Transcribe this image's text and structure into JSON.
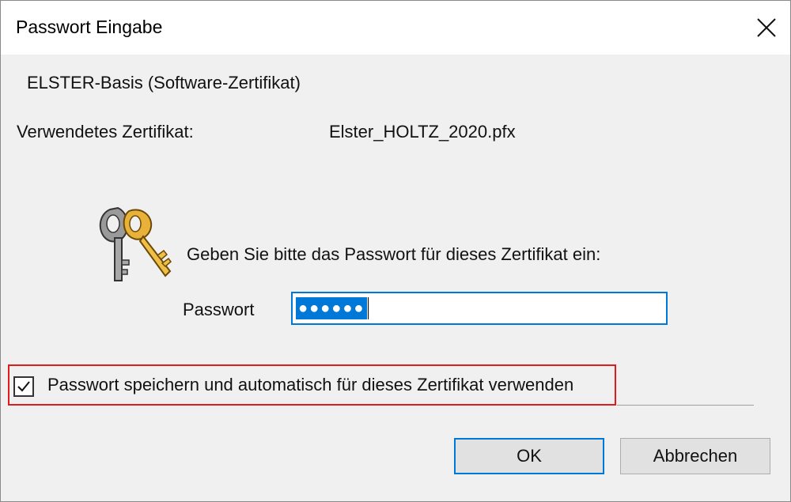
{
  "window": {
    "title": "Passwort Eingabe",
    "close_icon": "close-icon"
  },
  "certificate": {
    "type_text": "ELSTER-Basis (Software-Zertifikat)",
    "used_label": "Verwendetes Zertifikat:",
    "file_name": "Elster_HOLTZ_2020.pfx"
  },
  "prompt": {
    "icon": "keys-icon",
    "text": "Geben Sie bitte das Passwort für dieses Zertifikat ein:"
  },
  "password": {
    "label": "Passwort",
    "masked_value": "●●●●●●",
    "selected": true
  },
  "save_option": {
    "label": "Passwort speichern und automatisch für dieses Zertifikat verwenden",
    "checked": true,
    "highlight_color": "#e01b1b"
  },
  "buttons": {
    "ok_label": "OK",
    "cancel_label": "Abbrechen"
  },
  "colors": {
    "accent": "#0078d7",
    "dialog_bg": "#f0f0f0"
  }
}
